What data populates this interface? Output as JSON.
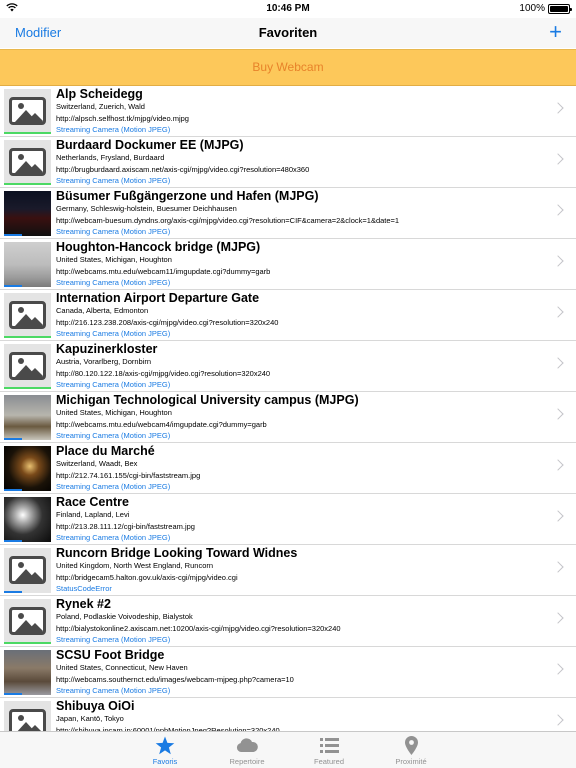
{
  "status_bar": {
    "time": "10:46 PM",
    "battery": "100%"
  },
  "nav": {
    "edit_label": "Modifier",
    "title": "Favoriten",
    "add_label": "+"
  },
  "buy": {
    "label": "Buy Webcam"
  },
  "colors": {
    "accent": "#1a7be3",
    "buy_bg": "#fdc85a",
    "buy_text": "#e8832a",
    "ok": "#4cd964",
    "blue_bar": "#1a7be3"
  },
  "cameras": [
    {
      "title": "Alp Scheidegg",
      "location": "Switzerland, Zuerich, Wald",
      "url": "http://alpsch.selfhost.tk/mjpg/video.mjpg",
      "status": "Streaming Camera (Motion JPEG)",
      "thumb": "placeholder-icon",
      "indicator": "green"
    },
    {
      "title": "Burdaard Dockumer EE (MJPG)",
      "location": "Netherlands, Frysland, Burdaard",
      "url": "http://brugburdaard.axiscam.net/axis-cgi/mjpg/video.cgi?resolution=480x360",
      "status": "Streaming Camera (Motion JPEG)",
      "thumb": "placeholder-icon",
      "indicator": "green"
    },
    {
      "title": "Büsumer Fußgängerzone und Hafen (MJPG)",
      "location": "Germany, Schleswig-holstein, Buesumer Deichhausen",
      "url": "http://webcam-buesum.dyndns.org/axis-cgi/mjpg/video.cgi?resolution=CIF&camera=2&clock=1&date=1",
      "status": "Streaming Camera (Motion JPEG)",
      "thumb": "night-harbor",
      "indicator": "blue"
    },
    {
      "title": "Houghton-Hancock bridge (MJPG)",
      "location": "United States, Michigan, Houghton",
      "url": "http://webcams.mtu.edu/webcam11/imgupdate.cgi?dummy=garb",
      "status": "Streaming Camera (Motion JPEG)",
      "thumb": "foggy-bridge",
      "indicator": "blue"
    },
    {
      "title": "Internation Airport Departure Gate",
      "location": "Canada, Alberta, Edmonton",
      "url": "http://216.123.238.208/axis-cgi/mjpg/video.cgi?resolution=320x240",
      "status": "Streaming Camera (Motion JPEG)",
      "thumb": "placeholder-icon",
      "indicator": "green"
    },
    {
      "title": "Kapuzinerkloster",
      "location": "Austria, Vorarlberg, Dornbirn",
      "url": "http://80.120.122.18/axis-cgi/mjpg/video.cgi?resolution=320x240",
      "status": "Streaming Camera (Motion JPEG)",
      "thumb": "placeholder-icon",
      "indicator": "green"
    },
    {
      "title": "Michigan Technological University campus (MJPG)",
      "location": "United States, Michigan, Houghton",
      "url": "http://webcams.mtu.edu/webcam4/imgupdate.cgi?dummy=garb",
      "status": "Streaming Camera (Motion JPEG)",
      "thumb": "campus",
      "indicator": "blue"
    },
    {
      "title": "Place du Marché",
      "location": "Switzerland, Waadt, Bex",
      "url": "http://212.74.161.155/cgi-bin/faststream.jpg",
      "status": "Streaming Camera (Motion JPEG)",
      "thumb": "night-square",
      "indicator": "blue"
    },
    {
      "title": "Race Centre",
      "location": "Finland, Lapland, Levi",
      "url": "http://213.28.111.12/cgi-bin/faststream.jpg",
      "status": "Streaming Camera (Motion JPEG)",
      "thumb": "night-snow",
      "indicator": "blue"
    },
    {
      "title": "Runcorn Bridge Looking Toward Widnes",
      "location": "United Kingdom, North West England, Runcorn",
      "url": "http://bridgecam5.halton.gov.uk/axis-cgi/mjpg/video.cgi",
      "status": "StatusCodeError",
      "thumb": "placeholder-icon",
      "indicator": "blue"
    },
    {
      "title": "Rynek #2",
      "location": "Poland, Podlaskie Voivodeship, Bialystok",
      "url": "http://bialystokonline2.axiscam.net:10200/axis-cgi/mjpg/video.cgi?resolution=320x240",
      "status": "Streaming Camera (Motion JPEG)",
      "thumb": "placeholder-icon",
      "indicator": "green"
    },
    {
      "title": "SCSU Foot Bridge",
      "location": "United States, Connecticut, New Haven",
      "url": "http://webcams.southernct.edu/images/webcam-mjpeg.php?camera=10",
      "status": "Streaming Camera (Motion JPEG)",
      "thumb": "footbridge",
      "indicator": "blue"
    },
    {
      "title": "Shibuya OiOi",
      "location": "Japan, Kantō, Tokyo",
      "url": "http://shibuya.ipcam.jp:60001/nphMotionJpeg?Resolution=320x240",
      "status": "",
      "thumb": "placeholder-icon",
      "indicator": "none"
    }
  ],
  "tabs": [
    {
      "label": "Favoris",
      "icon": "star-icon",
      "active": true
    },
    {
      "label": "Repertoire",
      "icon": "cloud-icon",
      "active": false
    },
    {
      "label": "Featured",
      "icon": "list-icon",
      "active": false
    },
    {
      "label": "Proximité",
      "icon": "location-pin-icon",
      "active": false
    }
  ]
}
